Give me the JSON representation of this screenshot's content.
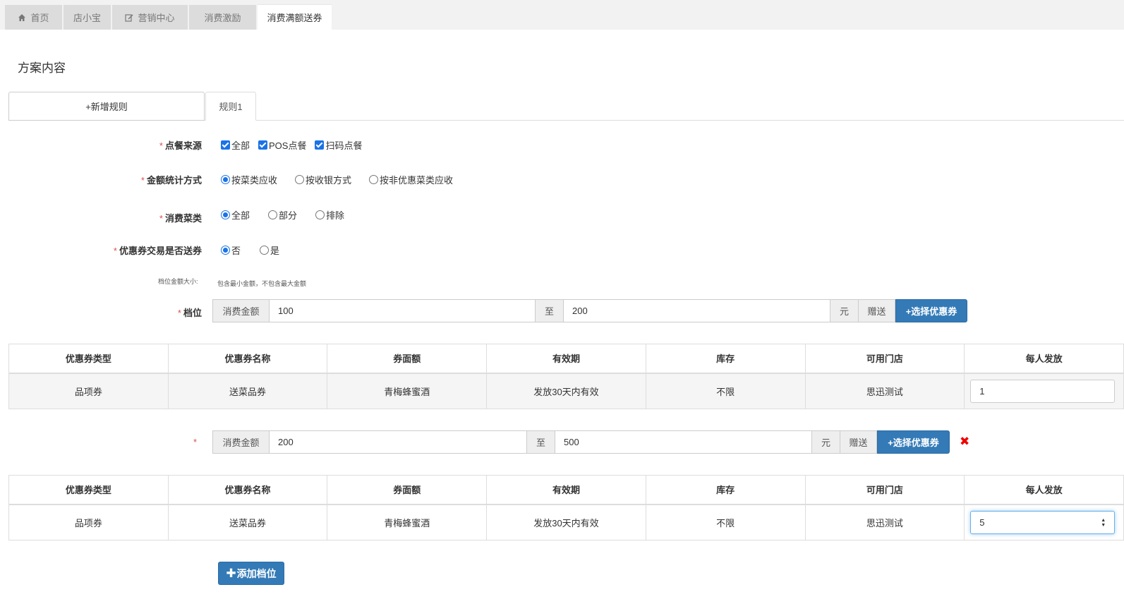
{
  "tabs": [
    {
      "label": "首页",
      "icon": "home-icon"
    },
    {
      "label": "店小宝",
      "icon": ""
    },
    {
      "label": "营销中心",
      "icon": "edit-icon"
    },
    {
      "label": "消费激励",
      "icon": ""
    },
    {
      "label": "消费满额送券",
      "icon": "",
      "active": true
    }
  ],
  "section_title": "方案内容",
  "rules": {
    "add_label": "+新增规则",
    "tab_label": "规则1"
  },
  "form": {
    "source": {
      "label": "点餐来源",
      "options": [
        "全部",
        "POS点餐",
        "扫码点餐"
      ]
    },
    "amount_method": {
      "label": "金额统计方式",
      "options": [
        "按菜类应收",
        "按收银方式",
        "按非优惠菜类应收"
      ],
      "selected": 0
    },
    "dish_category": {
      "label": "消费菜类",
      "options": [
        "全部",
        "部分",
        "排除"
      ],
      "selected": 0
    },
    "coupon_trade": {
      "label": "优惠券交易是否送券",
      "options": [
        "否",
        "是"
      ],
      "selected": 0
    },
    "tier_hint": {
      "label": "档位金额大小:",
      "note": "包含最小金额，不包含最大金额"
    },
    "tier_label": "档位"
  },
  "tier_common": {
    "amount_label": "消费金额",
    "to_label": "至",
    "unit_label": "元",
    "gift_label": "赠送",
    "select_btn": "+选择优惠券"
  },
  "columns": [
    "优惠券类型",
    "优惠券名称",
    "券面额",
    "有效期",
    "库存",
    "可用门店",
    "每人发放"
  ],
  "tiers": [
    {
      "min": "100",
      "max": "200",
      "row": {
        "type": "品项券",
        "name": "送菜品券",
        "face": "青梅蜂蜜酒",
        "validity": "发放30天内有效",
        "stock": "不限",
        "store": "思迅测试",
        "per_person": "1"
      }
    },
    {
      "min": "200",
      "max": "500",
      "row": {
        "type": "品项券",
        "name": "送菜品券",
        "face": "青梅蜂蜜酒",
        "validity": "发放30天内有效",
        "stock": "不限",
        "store": "思迅测试",
        "per_person": "5"
      }
    }
  ],
  "add_tier_label": "添加档位",
  "colors": {
    "primary": "#337ab7",
    "danger": "#d9534f",
    "check": "#1a73e8"
  }
}
